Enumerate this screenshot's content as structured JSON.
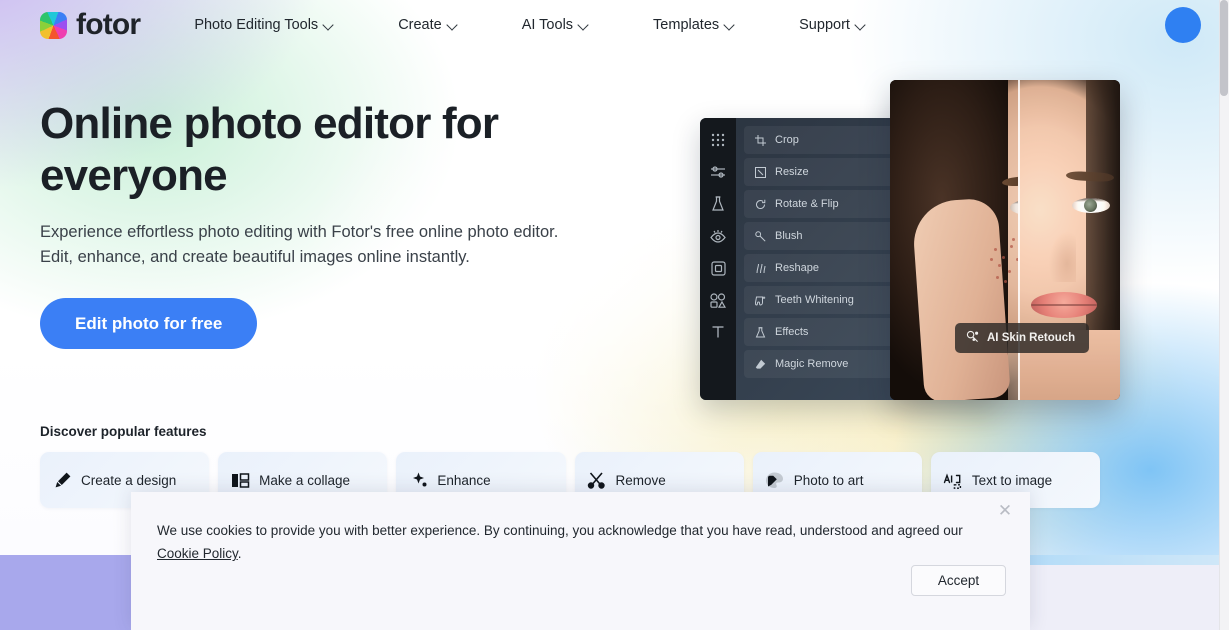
{
  "header": {
    "logo_text": "fotor",
    "logo_icon": "color-wheel-icon",
    "nav": [
      {
        "label": "Photo Editing Tools",
        "icon": "chevron-down-icon"
      },
      {
        "label": "Create",
        "icon": "chevron-down-icon"
      },
      {
        "label": "AI Tools",
        "icon": "chevron-down-icon"
      },
      {
        "label": "Templates",
        "icon": "chevron-down-icon"
      },
      {
        "label": "Support",
        "icon": "chevron-down-icon"
      }
    ],
    "avatar_label": ""
  },
  "hero": {
    "title": "Online photo editor for everyone",
    "subtitle": "Experience effortless photo editing with Fotor's free online photo editor. Edit, enhance, and create beautiful images online instantly.",
    "cta_label": "Edit photo for free",
    "cta_color": "#3b7ff5"
  },
  "editor_mockup": {
    "rail_icons": [
      "grid-dots-icon",
      "sliders-icon",
      "beauty-flask-icon",
      "eye-icon",
      "frame-icon",
      "shapes-icon",
      "text-icon"
    ],
    "tools": [
      {
        "label": "Crop",
        "icon": "crop-icon"
      },
      {
        "label": "Resize",
        "icon": "resize-icon"
      },
      {
        "label": "Rotate & Flip",
        "icon": "rotate-icon"
      },
      {
        "label": "Blush",
        "icon": "blush-icon"
      },
      {
        "label": "Reshape",
        "icon": "reshape-icon"
      },
      {
        "label": "Teeth Whitening",
        "icon": "teeth-icon"
      },
      {
        "label": "Effects",
        "icon": "effects-icon"
      },
      {
        "label": "Magic Remove",
        "icon": "magic-remove-icon"
      }
    ],
    "tooltip": {
      "label": "AI Skin Retouch",
      "icon": "ai-skin-retouch-icon"
    }
  },
  "features": {
    "heading": "Discover popular features",
    "cards": [
      {
        "label": "Create a design",
        "icon": "pen-design-icon"
      },
      {
        "label": "Make a collage",
        "icon": "collage-icon"
      },
      {
        "label": "Enhance",
        "icon": "magic-wand-icon"
      },
      {
        "label": "Remove",
        "icon": "scissors-icon"
      },
      {
        "label": "Photo to art",
        "icon": "photo-to-art-icon"
      },
      {
        "label": "Text to image",
        "icon": "text-to-image-icon"
      }
    ]
  },
  "cookie_banner": {
    "text_before_link": "We use cookies to provide you with better experience. By continuing, you acknowledge that you have read, understood and agreed our ",
    "link_label": "Cookie Policy",
    "text_after_link": ".",
    "accept_label": "Accept",
    "close_icon": "close-icon"
  }
}
